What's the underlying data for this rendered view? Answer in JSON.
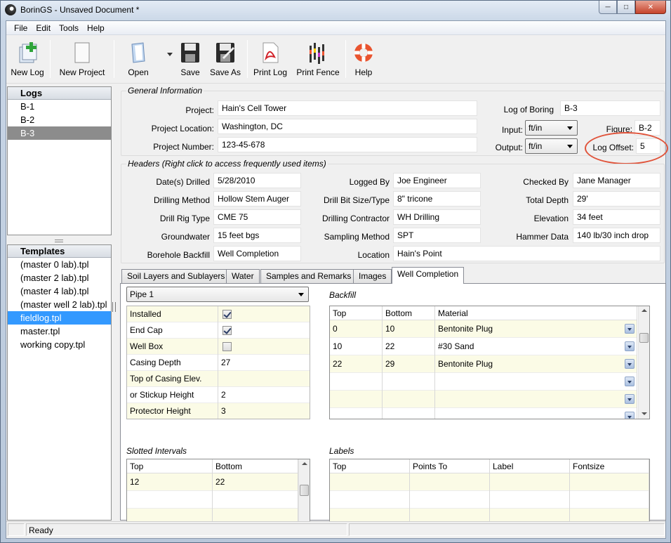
{
  "window": {
    "title": "BorinGS - Unsaved Document *"
  },
  "menu": [
    "File",
    "Edit",
    "Tools",
    "Help"
  ],
  "toolbar": {
    "new_log": "New Log",
    "new_project": "New Project",
    "open": "Open",
    "save": "Save",
    "save_as": "Save As",
    "print_log": "Print Log",
    "print_fence": "Print Fence",
    "help": "Help"
  },
  "logs": {
    "header": "Logs",
    "items": [
      "B-1",
      "B-2",
      "B-3"
    ],
    "selected": "B-3"
  },
  "templates": {
    "header": "Templates",
    "items": [
      "(master 0 lab).tpl",
      "(master 2 lab).tpl",
      "(master 4 lab).tpl",
      "(master well 2 lab).tpl",
      "fieldlog.tpl",
      "master.tpl",
      "working copy.tpl"
    ],
    "selected": "fieldlog.tpl"
  },
  "general": {
    "title": "General Information",
    "project_label": "Project:",
    "project": "Hain's Cell Tower",
    "location_label": "Project Location:",
    "location": "Washington, DC",
    "number_label": "Project Number:",
    "number": "123-45-678",
    "log_of_boring_label": "Log of Boring",
    "log_of_boring": "B-3",
    "input_label": "Input:",
    "input": "ft/in",
    "output_label": "Output:",
    "output": "ft/in",
    "figure_label": "Figure:",
    "figure": "B-2",
    "log_offset_label": "Log Offset:",
    "log_offset": "5"
  },
  "headers": {
    "title": "Headers (Right click to access frequently used items)",
    "dates_label": "Date(s) Drilled",
    "dates": "5/28/2010",
    "method_label": "Drilling Method",
    "method": "Hollow Stem Auger",
    "rig_label": "Drill Rig Type",
    "rig": "CME 75",
    "groundwater_label": "Groundwater",
    "groundwater": "15 feet bgs",
    "backfill_label": "Borehole Backfill",
    "backfill": "Well Completion",
    "logged_label": "Logged By",
    "logged": "Joe Engineer",
    "bit_label": "Drill Bit Size/Type",
    "bit": "8\" tricone",
    "contractor_label": "Drilling Contractor",
    "contractor": "WH Drilling",
    "sampling_label": "Sampling Method",
    "sampling": "SPT",
    "location_label": "Location",
    "location": "Hain's Point",
    "checked_label": "Checked By",
    "checked": "Jane Manager",
    "depth_label": "Total Depth",
    "depth": "29'",
    "elevation_label": "Elevation",
    "elevation": "34 feet",
    "hammer_label": "Hammer Data",
    "hammer": "140 lb/30 inch drop"
  },
  "tabs": [
    "Soil Layers and Sublayers",
    "Water",
    "Samples and Remarks",
    "Images",
    "Well Completion"
  ],
  "active_tab": "Well Completion",
  "well": {
    "pipe": "Pipe 1",
    "props": [
      {
        "label": "Installed",
        "checkbox": true,
        "checked": true,
        "value": ""
      },
      {
        "label": "End Cap",
        "checkbox": true,
        "checked": true,
        "value": ""
      },
      {
        "label": "Well Box",
        "checkbox": true,
        "checked": false,
        "value": ""
      },
      {
        "label": "Casing Depth",
        "checkbox": false,
        "value": "27"
      },
      {
        "label": "Top of Casing Elev.",
        "checkbox": false,
        "value": ""
      },
      {
        "label": "or Stickup Height",
        "checkbox": false,
        "value": "2"
      },
      {
        "label": "Protector Height",
        "checkbox": false,
        "value": "3"
      }
    ],
    "backfill_title": "Backfill",
    "backfill_cols": [
      "Top",
      "Bottom",
      "Material"
    ],
    "backfill_rows": [
      [
        "0",
        "10",
        "Bentonite Plug"
      ],
      [
        "10",
        "22",
        "#30 Sand"
      ],
      [
        "22",
        "29",
        "Bentonite Plug"
      ],
      [
        "",
        "",
        ""
      ],
      [
        "",
        "",
        ""
      ],
      [
        "",
        "",
        ""
      ]
    ],
    "slotted_title": "Slotted Intervals",
    "slotted_cols": [
      "Top",
      "Bottom"
    ],
    "slotted_rows": [
      [
        "12",
        "22"
      ],
      [
        "",
        ""
      ],
      [
        "",
        ""
      ],
      [
        "",
        ""
      ]
    ],
    "labels_title": "Labels",
    "labels_cols": [
      "Top",
      "Points To",
      "Label",
      "Fontsize"
    ],
    "labels_rows": [
      [
        "",
        "",
        "",
        ""
      ],
      [
        "",
        "",
        "",
        ""
      ],
      [
        "",
        "",
        "",
        ""
      ],
      [
        "",
        "",
        "",
        ""
      ]
    ]
  },
  "status": {
    "text": "Ready"
  },
  "colors": {
    "accent_highlight": "#e0533a",
    "selection_blue": "#3399ff",
    "row_alt": "#fbfbe6"
  }
}
